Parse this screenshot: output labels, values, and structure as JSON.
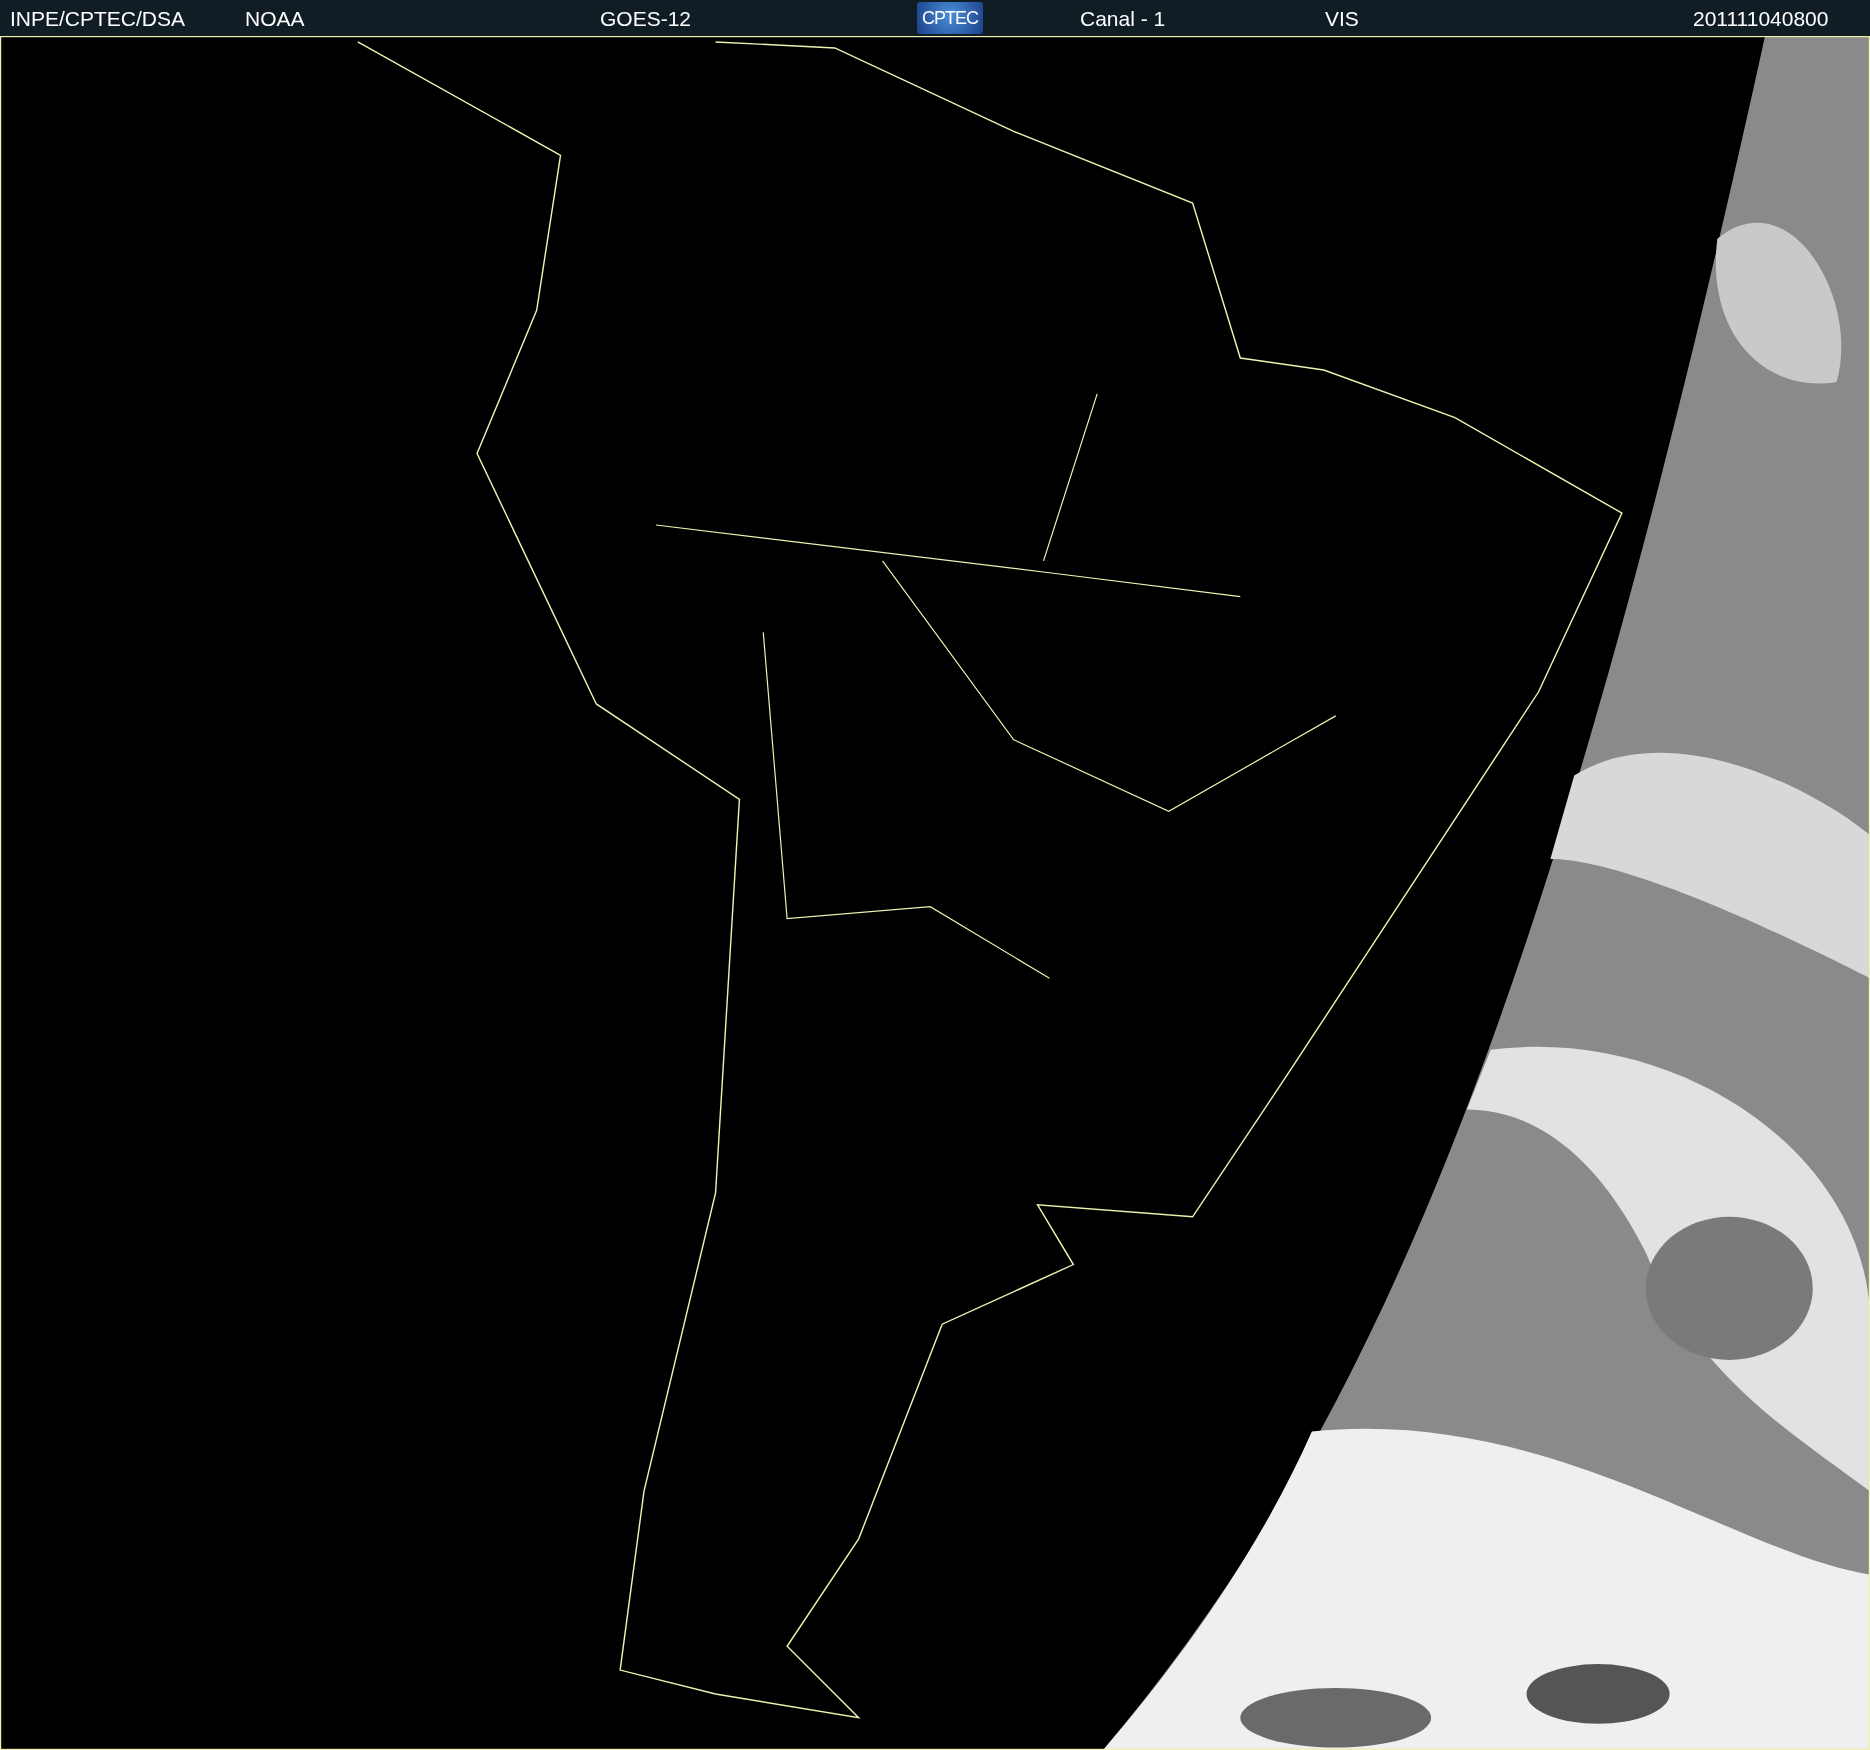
{
  "header": [
    {
      "kind": "text",
      "text": "INPE/CPTEC/DSA"
    },
    {
      "kind": "text",
      "text": "NOAA"
    },
    {
      "kind": "text",
      "text": "GOES-12"
    },
    {
      "kind": "logo",
      "text": "CPTEC"
    },
    {
      "kind": "text",
      "text": "Canal - 1"
    },
    {
      "kind": "text",
      "text": "VIS"
    },
    {
      "kind": "text",
      "text": "201111040800"
    }
  ]
}
